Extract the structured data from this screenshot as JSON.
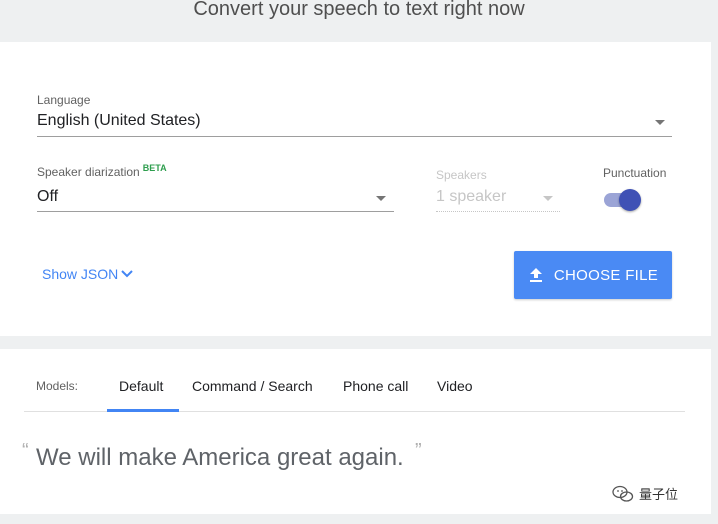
{
  "heading": "Convert your speech to text right now",
  "language": {
    "label": "Language",
    "value": "English (United States)"
  },
  "diarization": {
    "label": "Speaker diarization",
    "badge": "BETA",
    "value": "Off"
  },
  "speakers": {
    "label": "Speakers",
    "value": "1 speaker",
    "enabled": false
  },
  "punctuation": {
    "label": "Punctuation",
    "enabled": true
  },
  "show_json": "Show JSON",
  "choose_file": "CHOOSE FILE",
  "models": {
    "label": "Models:",
    "tabs": [
      "Default",
      "Command / Search",
      "Phone call",
      "Video"
    ],
    "active": "Default"
  },
  "transcript": {
    "open_quote": "“",
    "text": "We will make America great again.",
    "close_quote": "”"
  },
  "watermark": "量子位",
  "colors": {
    "accent": "#4285f4",
    "button": "#4a8af4",
    "toggle": "#3f51b5",
    "beta": "#2e9e4e"
  },
  "icons": [
    "chevron-down-icon",
    "upload-icon",
    "dropdown-arrow-icon",
    "wechat-logo-icon"
  ]
}
